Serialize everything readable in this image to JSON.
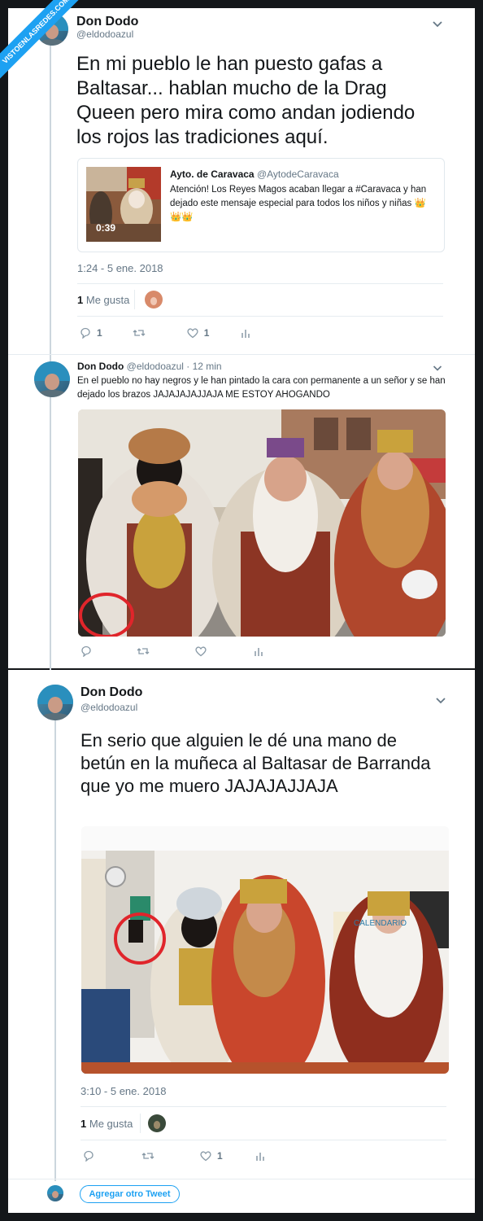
{
  "watermark": "VISTOENLASREDES.COM",
  "tweet1": {
    "name": "Don Dodo",
    "handle": "@eldodoazul",
    "text": "En mi pueblo le han puesto gafas a Baltasar... hablan mucho de la Drag Queen pero mira como andan jodiendo los rojos las tradiciones aquí.",
    "quote": {
      "name": "Ayto. de Caravaca",
      "handle": "@AytodeCaravaca",
      "text": "Atención! Los Reyes Magos acaban llegar a  #Caravaca y han dejado este mensaje especial para todos los niños y niñas 👑👑👑",
      "duration": "0:39"
    },
    "timestamp": "1:24 - 5 ene. 2018",
    "likes_count": "1",
    "likes_label": "Me gusta",
    "reply_count": "1",
    "like_count": "1"
  },
  "reply": {
    "name": "Don Dodo",
    "handle": "@eldodoazul",
    "time": "· 12 min",
    "text": "En el pueblo no hay negros y le han pintado la cara con permanente a un señor y se han dejado los brazos JAJAJAJAJJAJA ME ESTOY AHOGANDO"
  },
  "tweet2": {
    "name": "Don Dodo",
    "handle": "@eldodoazul",
    "text": "En serio que alguien le dé una mano de betún en la muñeca al Baltasar de Barranda que yo me muero JAJAJAJJAJA",
    "photo_sign": "CALENDARIO",
    "timestamp": "3:10 - 5 ene. 2018",
    "likes_count": "1",
    "likes_label": "Me gusta",
    "like_count": "1",
    "add_button": "Agregar otro Tweet"
  },
  "colors": {
    "accent": "#1da1f2",
    "muted": "#657786",
    "circle": "#e0252b"
  }
}
